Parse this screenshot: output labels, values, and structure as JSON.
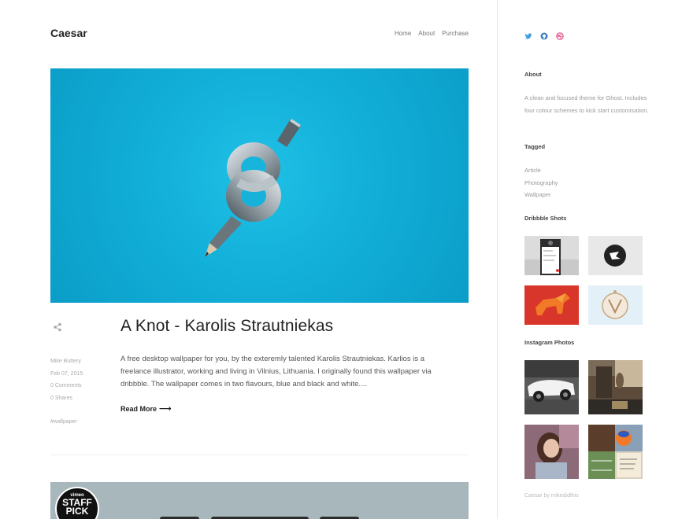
{
  "site": {
    "brand": "Caesar"
  },
  "nav": [
    "Home",
    "About",
    "Purchase"
  ],
  "post": {
    "title": "A Knot - Karolis Strautniekas",
    "author": "Mike Buttery",
    "date": "Feb 07, 2015",
    "comments": "0 Comments",
    "shares": "0 Shares",
    "tag": "#wallpaper",
    "excerpt": "A free desktop wallpaper for you, by the exteremly talented Karolis Strautniekas. Karlios is a freelance illustrator, working and living in Vilnius, Lithuania. I originally found this wallpaper via dribbble. The wallpaper comes in two flavours, blue and black and white....",
    "read_more": "Read More",
    "hero_color": "#12afd8"
  },
  "next_post": {
    "badge_top": "vimeo",
    "badge_main": "STAFF PICK"
  },
  "sidebar": {
    "social_icons": [
      "twitter-icon",
      "github-icon",
      "dribbble-icon"
    ],
    "about_heading": "About",
    "about_text": "A clean and focused theme for Ghost. Includes four colour schemes to kick start customisation.",
    "tagged_heading": "Tagged",
    "tags": [
      "Article",
      "Photography",
      "Wallpaper"
    ],
    "dribbble_heading": "Dribbble Shots",
    "instagram_heading": "Instagram Photos",
    "footer": "Caesar by mikedidthis"
  }
}
